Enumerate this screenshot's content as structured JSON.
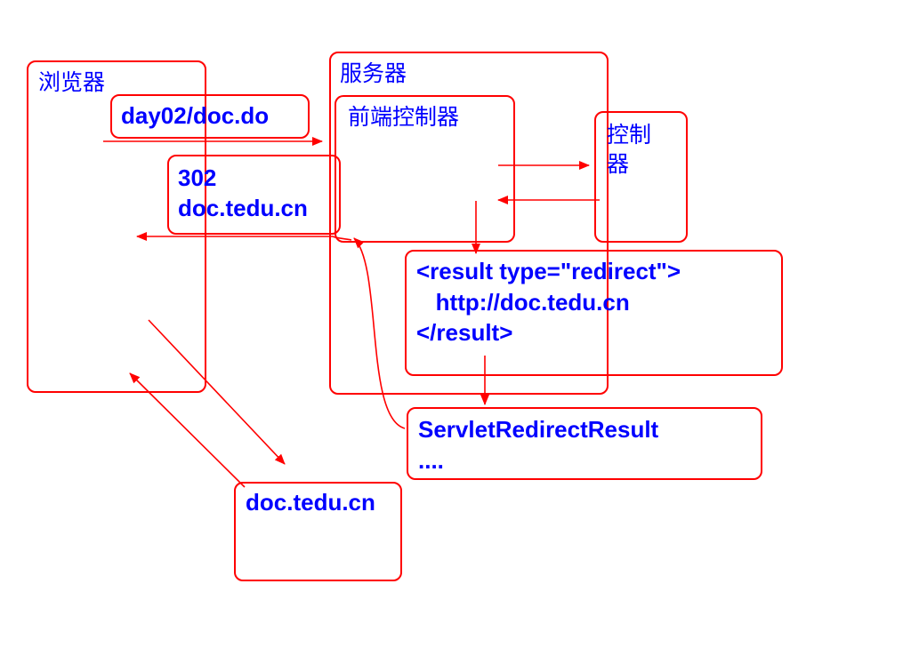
{
  "colors": {
    "border": "#ff0000",
    "text": "#0000ff",
    "arrow": "#ff0000",
    "background": "#ffffff"
  },
  "browser": {
    "label": "浏览器"
  },
  "server": {
    "label": "服务器"
  },
  "front_controller": {
    "label": "前端控制器"
  },
  "controller": {
    "line1": "控制",
    "line2": "器"
  },
  "request_box": {
    "text": "day02/doc.do"
  },
  "response_box": {
    "line1": "302",
    "line2": "doc.tedu.cn"
  },
  "result_config": {
    "line1": "<result type=\"redirect\">",
    "line2": "   http://doc.tedu.cn",
    "line3": "</result>"
  },
  "redirect_result": {
    "line1": "ServletRedirectResult",
    "line2": "...."
  },
  "target_site": {
    "label": "doc.tedu.cn"
  }
}
